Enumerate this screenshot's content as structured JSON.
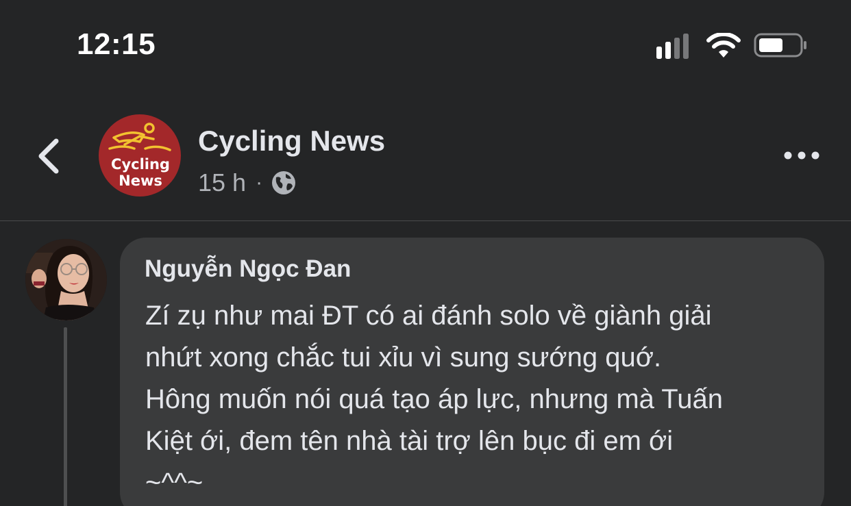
{
  "status_bar": {
    "time": "12:15",
    "icons": [
      "cellular-signal-icon",
      "wifi-icon",
      "battery-icon"
    ]
  },
  "post": {
    "back_icon": "chevron-left-icon",
    "page_name": "Cycling News",
    "avatar_text": [
      "Cycling",
      "News"
    ],
    "time_ago": "15 h",
    "separator": "·",
    "audience_icon": "globe-icon",
    "more_icon": "more-horizontal-icon"
  },
  "comment": {
    "author": "Nguyễn Ngọc Đan",
    "lines": [
      "Zí zụ như mai ĐT có ai đánh solo về giành giải",
      "nhứt xong chắc tui xỉu vì sung sướng quớ.",
      "Hông muốn nói quá tạo áp lực, nhưng mà Tuấn",
      "Kiệt ới, đem tên nhà tài trợ lên bục đi em ới",
      "~^^~"
    ]
  },
  "colors": {
    "background": "#242526",
    "bubble": "#3a3b3c",
    "primary_text": "#e4e6eb",
    "secondary_text": "#b0b3b8",
    "avatar_red": "#a3282a",
    "logo_yellow": "#f2c230"
  }
}
